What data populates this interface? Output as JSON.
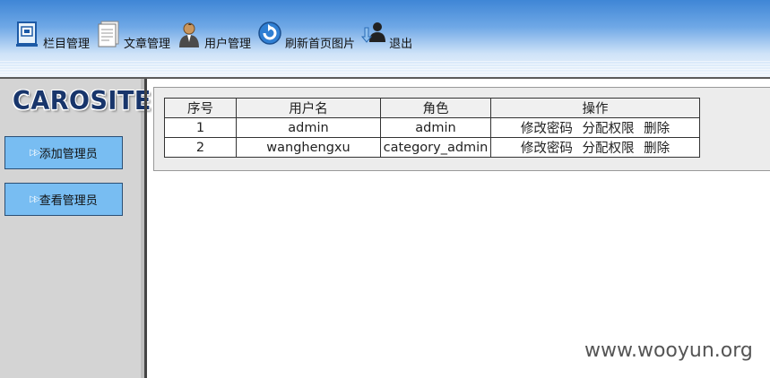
{
  "nav": {
    "items": [
      {
        "label": "栏目管理",
        "icon": "column-manage-icon"
      },
      {
        "label": "文章管理",
        "icon": "document-icon"
      },
      {
        "label": "用户管理",
        "icon": "user-icon"
      },
      {
        "label": "刷新首页图片",
        "icon": "refresh-icon"
      },
      {
        "label": "退出",
        "icon": "logout-icon"
      }
    ]
  },
  "sidebar": {
    "logo": "CAROSITE",
    "buttons": [
      {
        "label": "添加管理员"
      },
      {
        "label": "查看管理员"
      }
    ]
  },
  "table": {
    "headers": [
      "序号",
      "用户名",
      "角色",
      "操作"
    ],
    "rows": [
      {
        "index": "1",
        "username": "admin",
        "role": "admin",
        "actions": [
          "修改密码",
          "分配权限",
          "删除"
        ]
      },
      {
        "index": "2",
        "username": "wanghengxu",
        "role": "category_admin",
        "actions": [
          "修改密码",
          "分配权限",
          "删除"
        ]
      }
    ]
  },
  "watermark": "www.wooyun.org",
  "colors": {
    "accent_blue": "#3f86d6",
    "sidebar_button": "#78bdf2",
    "sidebar_bg": "#d4d4d4"
  }
}
